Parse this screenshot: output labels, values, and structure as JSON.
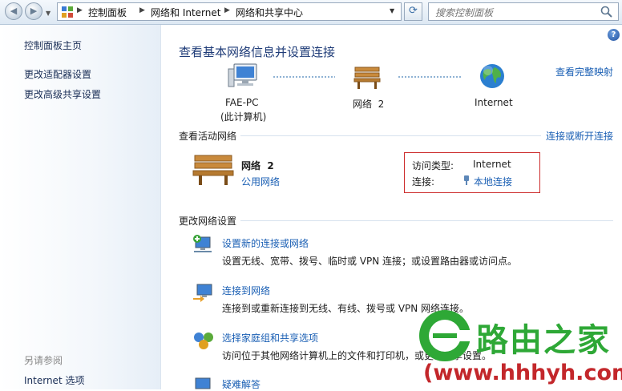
{
  "address_bar": {
    "breadcrumbs": [
      "控制面板",
      "网络和 Internet",
      "网络和共享中心"
    ],
    "search_placeholder": "搜索控制面板"
  },
  "left_pane": {
    "links": [
      "控制面板主页",
      "更改适配器设置",
      "更改高级共享设置"
    ],
    "see_also_title": "另请参阅",
    "see_also_links": [
      "Internet 选项"
    ]
  },
  "main": {
    "title": "查看基本网络信息并设置连接",
    "view_full_map": "查看完整映射",
    "map": {
      "computer_name": "FAE-PC",
      "computer_sub": "(此计算机)",
      "network_name": "网络  2",
      "internet": "Internet"
    },
    "active_section_title": "查看活动网络",
    "connect_disconnect": "连接或断开连接",
    "active_network": {
      "name": "网络  2",
      "type": "公用网络",
      "access_type_label": "访问类型:",
      "access_type_value": "Internet",
      "connection_label": "连接:",
      "connection_value": "本地连接"
    },
    "change_section_title": "更改网络设置",
    "tasks": [
      {
        "title": "设置新的连接或网络",
        "desc": "设置无线、宽带、拨号、临时或 VPN 连接；或设置路由器或访问点。"
      },
      {
        "title": "连接到网络",
        "desc": "连接到或重新连接到无线、有线、拨号或 VPN 网络连接。"
      },
      {
        "title": "选择家庭组和共享选项",
        "desc": "访问位于其他网络计算机上的文件和打印机，或更改共享设置。"
      },
      {
        "title": "疑难解答",
        "desc": ""
      }
    ]
  },
  "watermark": {
    "brand": "路由之家",
    "url": "(www.hhhyh.com)",
    "color": "#2ea836",
    "url_color": "#c3272b"
  }
}
